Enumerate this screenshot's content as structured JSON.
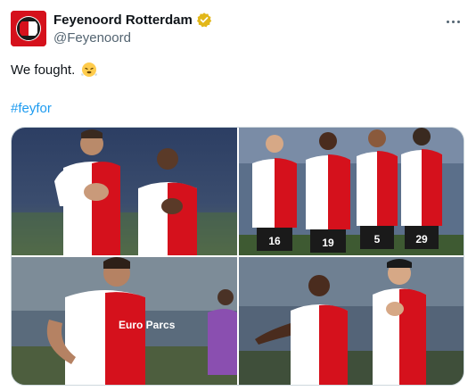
{
  "author": {
    "display_name": "Feyenoord Rotterdam",
    "handle": "@Feyenoord",
    "verified_badge_color": "#e2b719",
    "avatar_icon": "feyenoord-crest-icon",
    "brand_color": "#d5111c"
  },
  "tweet": {
    "text": "We fought.",
    "emoji": "face-with-steam-from-nose-emoji",
    "hashtag": "#feyfor",
    "hashtag_color": "#1d9bf0"
  },
  "media": {
    "photos": [
      {
        "jersey_numbers": []
      },
      {
        "jersey_numbers": [
          "16",
          "19",
          "5",
          "29"
        ]
      },
      {
        "jersey_numbers": []
      },
      {
        "jersey_numbers": []
      }
    ],
    "shirt_sponsor": "Euro Parcs"
  }
}
